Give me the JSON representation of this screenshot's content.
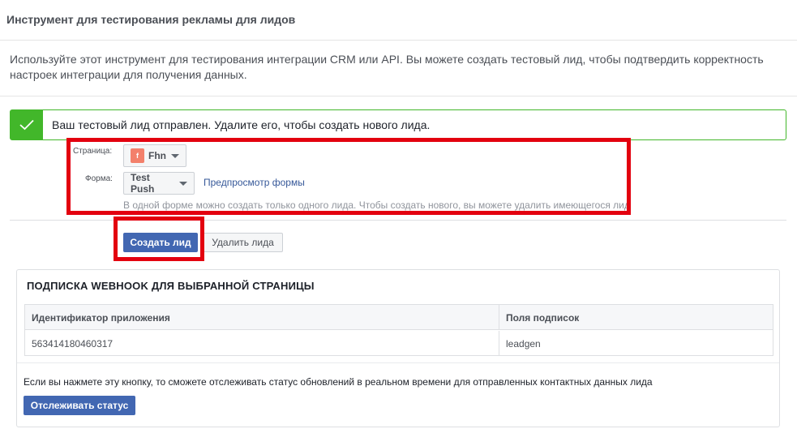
{
  "header": {
    "title": "Инструмент для тестирования рекламы для лидов"
  },
  "intro": {
    "text": "Используйте этот инструмент для тестирования интеграции CRM или API. Вы можете создать тестовый лид, чтобы подтвердить корректность настроек интеграции для получения данных."
  },
  "success": {
    "message": "Ваш тестовый лид отправлен. Удалите его, чтобы создать нового лида.",
    "icon": "check-icon",
    "color": "#42b72a"
  },
  "form": {
    "page_label": "Страница:",
    "page_value": "Fhn",
    "form_label": "Форма:",
    "form_value": "Test Push",
    "preview_link": "Предпросмотр формы",
    "hint": "В одной форме можно создать только одного лида. Чтобы создать нового, вы можете удалить имеющегося лида."
  },
  "actions": {
    "create_label": "Создать лид",
    "delete_label": "Удалить лида",
    "primary_color": "#4267b2"
  },
  "webhook": {
    "title": "ПОДПИСКА WEBHOOK ДЛЯ ВЫБРАННОЙ СТРАНИЦЫ",
    "columns": [
      "Идентификатор приложения",
      "Поля подписок"
    ],
    "rows": [
      [
        "563414180460317",
        "leadgen"
      ]
    ],
    "note": "Если вы нажмете эту кнопку, то сможете отслеживать статус обновлений в реальном времени для отправленных контактных данных лида",
    "track_label": "Отслеживать статус"
  },
  "annotations": {
    "highlight_color": "#e3000f"
  }
}
